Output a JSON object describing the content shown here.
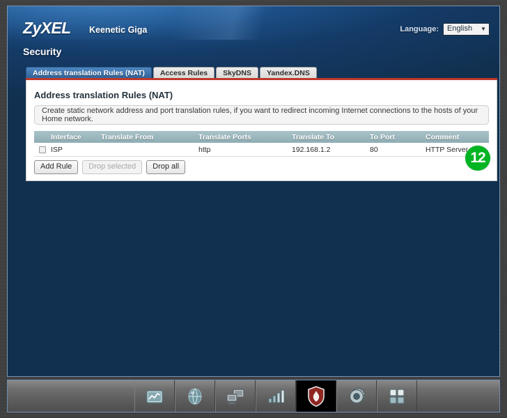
{
  "header": {
    "logo": "ZyXEL",
    "model": "Keenetic Giga",
    "language_label": "Language:",
    "language_value": "English",
    "caret": "▼"
  },
  "page": {
    "title": "Security"
  },
  "tabs": [
    {
      "label": "Address translation Rules (NAT)",
      "active": true
    },
    {
      "label": "Access Rules",
      "active": false
    },
    {
      "label": "SkyDNS",
      "active": false
    },
    {
      "label": "Yandex.DNS",
      "active": false
    }
  ],
  "panel": {
    "title": "Address translation Rules (NAT)",
    "note": "Create static network address and port translation rules, if you want to redirect incoming Internet connections to the hosts of your Home network."
  },
  "table": {
    "columns": [
      "Interface",
      "Translate From",
      "Translate Ports",
      "Translate To",
      "To Port",
      "Comment"
    ],
    "rows": [
      {
        "interface": "ISP",
        "translate_from": "",
        "translate_ports": "http",
        "translate_to": "192.168.1.2",
        "to_port": "80",
        "comment": "HTTP Server"
      }
    ]
  },
  "buttons": {
    "add_rule": "Add Rule",
    "drop_selected": "Drop selected",
    "drop_all": "Drop all"
  },
  "annotation": {
    "step": "12",
    "color": "#00b422"
  },
  "taskbar": {
    "items": [
      {
        "icon": "system-monitor-icon",
        "active": false
      },
      {
        "icon": "internet-globe-icon",
        "active": false
      },
      {
        "icon": "home-network-icon",
        "active": false
      },
      {
        "icon": "wifi-signal-icon",
        "active": false
      },
      {
        "icon": "security-shield-icon",
        "active": true
      },
      {
        "icon": "settings-gear-icon",
        "active": false
      },
      {
        "icon": "applications-grid-icon",
        "active": false
      }
    ]
  }
}
